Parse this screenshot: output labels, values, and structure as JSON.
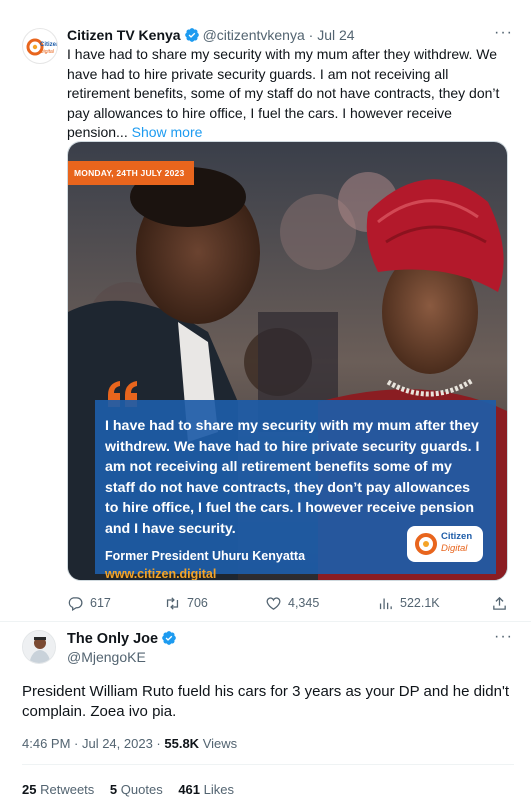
{
  "quoted_tweet": {
    "author_name": "Citizen TV Kenya",
    "handle": "@citizentvkenya",
    "separator": "·",
    "time": "Jul 24",
    "text": "I have had to share my security with my mum after they withdrew. We have had to hire private security guards. I am not receiving all retirement benefits, some of my staff do not have contracts, they don’t pay allowances to hire office, I fuel the cars. I however receive pension...",
    "show_more": "Show more",
    "avatar_logo": "Citizen Digital",
    "media": {
      "date_banner": "MONDAY, 24TH JULY 2023",
      "quote_text": "I have had to share my security with my mum after they withdrew. We have had to hire private security guards. I am not receiving all retirement benefits some of my staff do not have contracts, they don’t pay allowances to hire office, I fuel the cars. I however receive pension and I have security.",
      "attribution": "Former President Uhuru Kenyatta",
      "site": "www.citizen.digital",
      "logo_line1": "Citizen",
      "logo_line2": "Digital"
    },
    "actions": {
      "replies": "617",
      "retweets": "706",
      "likes": "4,345",
      "views": "522.1K"
    }
  },
  "tweet": {
    "author_name": "The Only Joe",
    "handle": "@MjengoKE",
    "text": "President William Ruto fueld his cars for 3 years as your DP and he didn't complain. Zoea ivo pia.",
    "timestamp": "4:46 PM · Jul 24, 2023 ·",
    "views_count": "55.8K",
    "views_label": "Views",
    "retweets_count": "25",
    "retweets_label": "Retweets",
    "quotes_count": "5",
    "quotes_label": "Quotes",
    "likes_count": "461",
    "likes_label": "Likes"
  },
  "colors": {
    "verified": "#1d9bf0",
    "link": "#1d9bf0",
    "banner_orange": "#e8651d",
    "quote_blue": "#1d5ca8",
    "site_gold": "#f4a428"
  }
}
